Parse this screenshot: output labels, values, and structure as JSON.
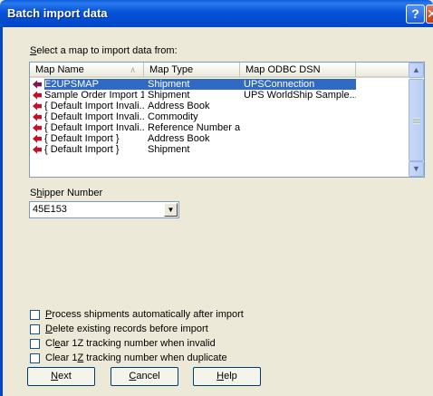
{
  "window": {
    "title": "Batch import data",
    "help_glyph": "?",
    "close_glyph": "✕"
  },
  "map_prompt": {
    "prefix": "",
    "underline": "S",
    "rest": "elect a map to import data from:"
  },
  "list": {
    "columns": [
      "Map Name",
      "Map Type",
      "Map ODBC DSN"
    ],
    "rows": [
      {
        "name": "E2UPSMAP",
        "type": "Shipment",
        "dsn": "UPSConnection",
        "selected": true
      },
      {
        "name": "Sample Order Import 1",
        "type": "Shipment",
        "dsn": "UPS WorldShip Sample..."
      },
      {
        "name": "{ Default Import Invali...",
        "type": "Address Book",
        "dsn": ""
      },
      {
        "name": "{ Default Import Invali...",
        "type": "Commodity",
        "dsn": ""
      },
      {
        "name": "{ Default Import Invali...",
        "type": "Reference Number a...",
        "dsn": ""
      },
      {
        "name": "{ Default Import }",
        "type": "Address Book",
        "dsn": ""
      },
      {
        "name": "{ Default Import }",
        "type": "Shipment",
        "dsn": ""
      }
    ]
  },
  "shipper": {
    "label_pre": "S",
    "label_underline": "h",
    "label_post": "ipper Number",
    "value": "45E153"
  },
  "options": [
    {
      "pre": "",
      "u": "P",
      "post": "rocess shipments automatically after import"
    },
    {
      "pre": "",
      "u": "D",
      "post": "elete existing records before import"
    },
    {
      "pre": "Cl",
      "u": "e",
      "post": "ar 1Z tracking number when invalid"
    },
    {
      "pre": "Clear 1",
      "u": "Z",
      "post": " tracking number when duplicate"
    }
  ],
  "buttons": {
    "next": {
      "u": "N",
      "rest": "ext"
    },
    "cancel": {
      "u": "C",
      "rest": "ancel"
    },
    "help": {
      "u": "H",
      "rest": "elp"
    }
  }
}
